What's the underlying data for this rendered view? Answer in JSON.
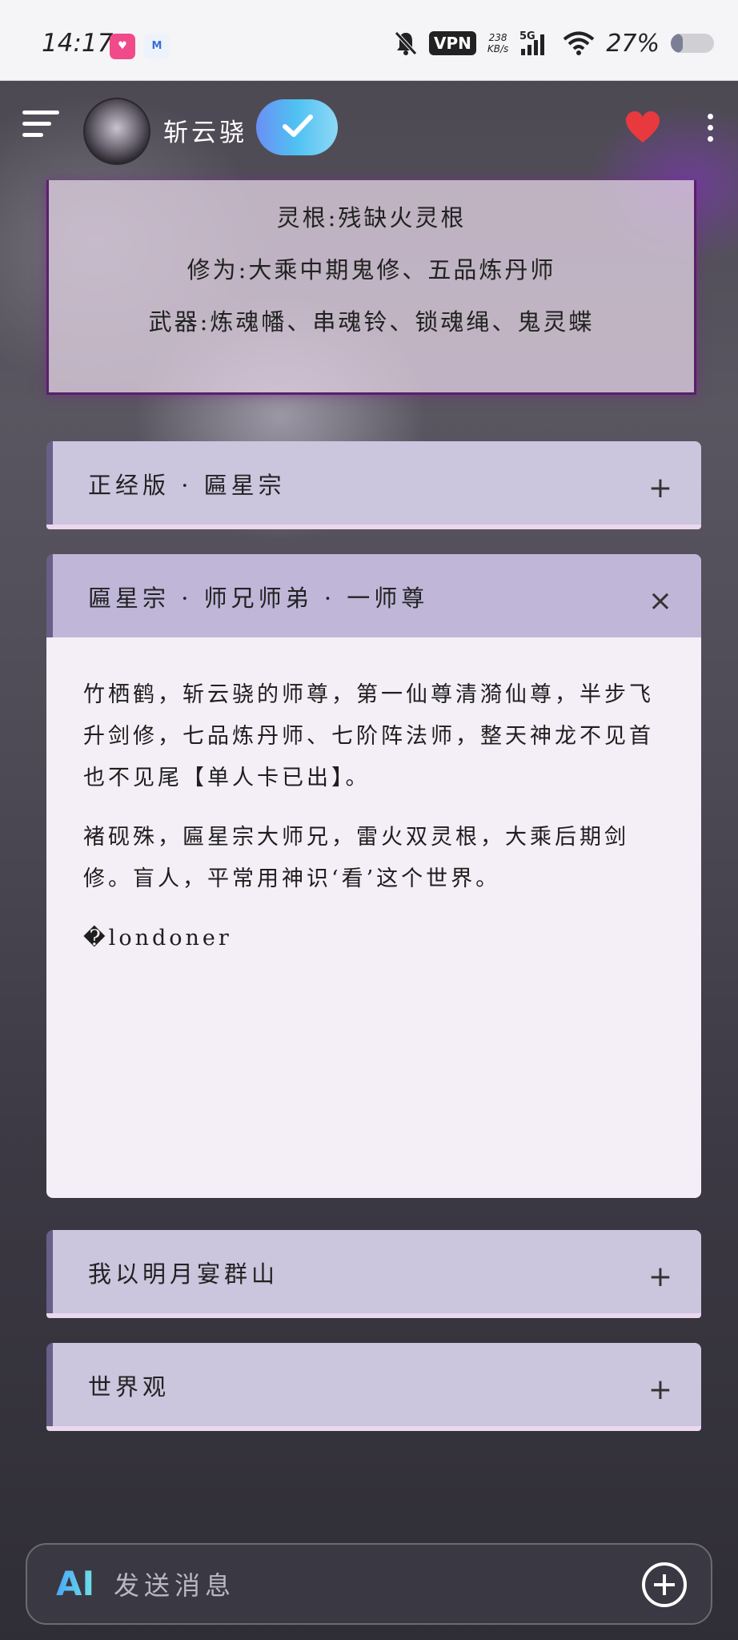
{
  "status_bar": {
    "time": "14:17",
    "apps": [
      "lofter-app-icon",
      "m-app-icon"
    ],
    "vpn_label": "VPN",
    "speed_value": "238",
    "speed_unit": "KB/s",
    "network": "5G",
    "battery_percent": "27%",
    "battery_level": 0.27
  },
  "header": {
    "username": "斩云骁",
    "verified": true,
    "favorite": true
  },
  "profile": {
    "lines": [
      "灵根:残缺火灵根",
      "修为:大乘中期鬼修、五品炼丹师",
      "武器:炼魂幡、串魂铃、锁魂绳、鬼灵蝶"
    ]
  },
  "sections": [
    {
      "title": "正经版 · 匾星宗",
      "icon": "+"
    },
    {
      "title": "匾星宗 · 师兄师弟 · 一师尊",
      "icon": "×",
      "paragraphs": [
        "竹栖鹤，斩云骁的师尊，第一仙尊清漪仙尊，半步飞升剑修，七品炼丹师、七阶阵法师，整天神龙不见首也不见尾【单人卡已出】。",
        "褚砚殊，匾星宗大师兄，雷火双灵根，大乘后期剑修。盲人，平常用神识‘看’这个世界。",
        "�londoner"
      ]
    },
    {
      "title": "我以明月宴群山",
      "icon": "+"
    },
    {
      "title": "世界观",
      "icon": "+"
    }
  ],
  "input": {
    "ai_label": "AI",
    "placeholder": "发送消息"
  }
}
